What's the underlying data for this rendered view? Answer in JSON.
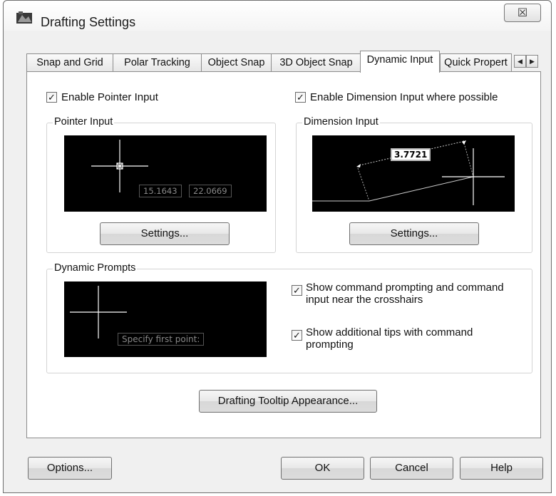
{
  "window": {
    "title": "Drafting Settings",
    "close_glyph": "☒"
  },
  "tabs": [
    {
      "label": "Snap and Grid"
    },
    {
      "label": "Polar Tracking"
    },
    {
      "label": "Object Snap"
    },
    {
      "label": "3D Object Snap"
    },
    {
      "label": "Dynamic Input",
      "active": true
    },
    {
      "label": "Quick Propert"
    }
  ],
  "tab_scroll": {
    "left": "◀",
    "right": "▶"
  },
  "pointer_input": {
    "enable_label": "Enable Pointer Input",
    "enabled": true,
    "group_title": "Pointer Input",
    "preview_x": "15.1643",
    "preview_y": "22.0669",
    "settings_label": "Settings..."
  },
  "dimension_input": {
    "enable_label": "Enable Dimension Input where possible",
    "enabled": true,
    "group_title": "Dimension Input",
    "preview_value": "3.7721",
    "settings_label": "Settings..."
  },
  "dynamic_prompts": {
    "group_title": "Dynamic Prompts",
    "preview_text": "Specify first point:",
    "show_command_line1": "Show command prompting and command",
    "show_command_line2": "input near the crosshairs",
    "show_command_checked": true,
    "show_tips_line1": "Show additional tips with command",
    "show_tips_line2": "prompting",
    "show_tips_checked": true
  },
  "tooltip_button": "Drafting Tooltip Appearance...",
  "footer": {
    "options": "Options...",
    "ok": "OK",
    "cancel": "Cancel",
    "help": "Help"
  },
  "icons": {
    "check": "✓"
  },
  "colors": {
    "preview_bg": "#000000",
    "crosshair": "#ffffff",
    "dialog_bg": "#f0f0f0"
  }
}
